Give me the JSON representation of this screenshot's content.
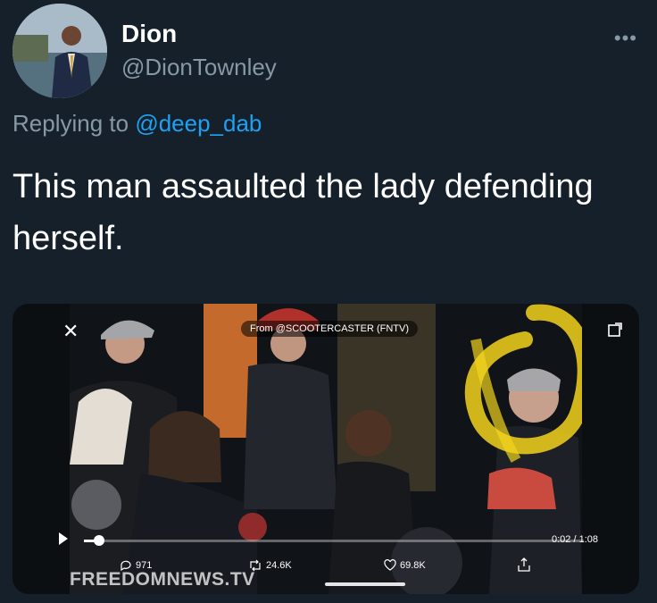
{
  "author": {
    "name": "Dion",
    "handle": "@DionTownley"
  },
  "menu": {
    "more_label": "•••"
  },
  "reply": {
    "prefix": "Replying to ",
    "mention": "@deep_dab"
  },
  "tweet": {
    "text": "This man assaulted the lady defending herself."
  },
  "video": {
    "close_label": "✕",
    "source_label": "From @SCOOTERCASTER (FNTV)",
    "time": "0:02 / 1:08",
    "progress": 0.03,
    "replies": "971",
    "retweets": "24.6K",
    "likes": "69.8K",
    "watermark": "FREEDOMNEWS.TV"
  },
  "colors": {
    "background": "#15202b",
    "link": "#1da1f2",
    "muted": "#8899a6",
    "highlight": "#f2d41c"
  }
}
